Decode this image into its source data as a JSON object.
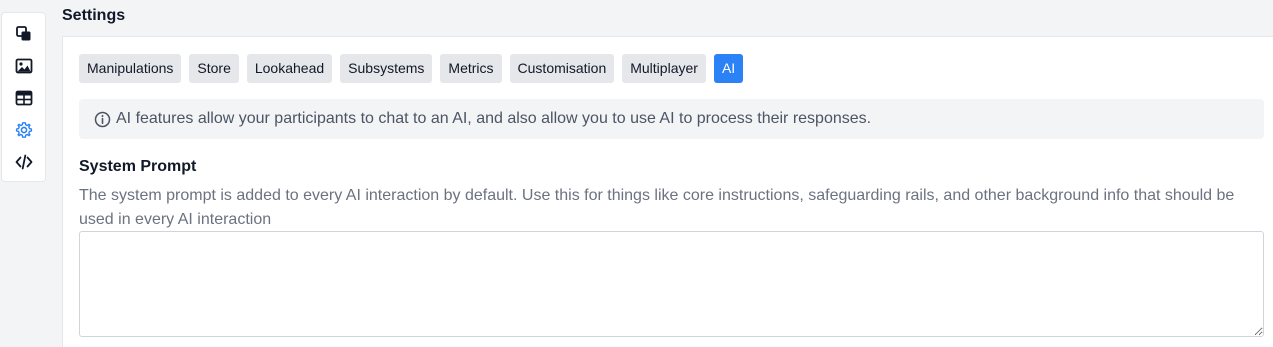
{
  "sidebar": {
    "items": [
      {
        "icon": "copy-icon"
      },
      {
        "icon": "image-icon"
      },
      {
        "icon": "table-icon"
      },
      {
        "icon": "gear-icon",
        "active": true
      },
      {
        "icon": "code-icon"
      }
    ]
  },
  "header": {
    "title": "Settings"
  },
  "tabs": [
    {
      "label": "Manipulations"
    },
    {
      "label": "Store"
    },
    {
      "label": "Lookahead"
    },
    {
      "label": "Subsystems"
    },
    {
      "label": "Metrics"
    },
    {
      "label": "Customisation"
    },
    {
      "label": "Multiplayer"
    },
    {
      "label": "AI",
      "active": true
    }
  ],
  "info": {
    "icon": "info-icon",
    "text": "AI features allow your participants to chat to an AI, and also allow you to use AI to process their responses."
  },
  "system_prompt": {
    "title": "System Prompt",
    "description": "The system prompt is added to every AI interaction by default. Use this for things like core instructions, safeguarding rails, and other background info that should be used in every AI interaction",
    "value": ""
  },
  "colors": {
    "accent": "#2b82f6",
    "tab_bg": "#e5e7eb",
    "info_bg": "#f3f4f6"
  }
}
